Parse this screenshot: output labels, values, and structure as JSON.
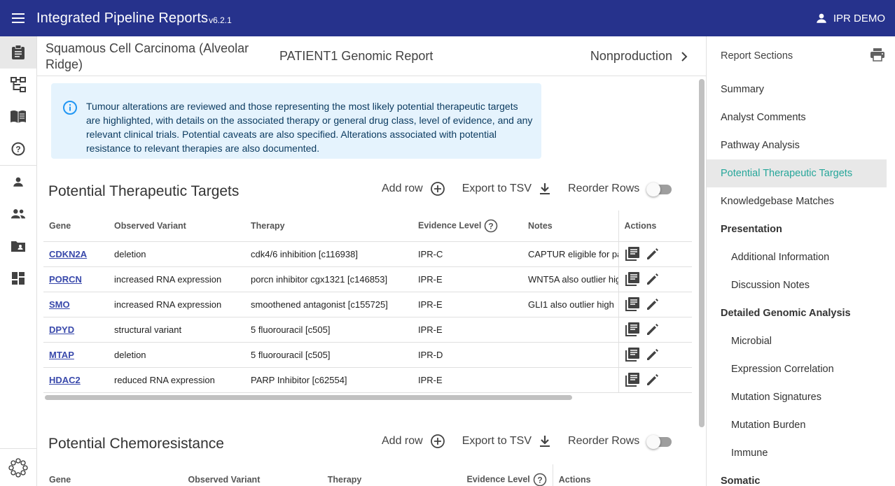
{
  "app": {
    "title": "Integrated Pipeline Reports",
    "version": "v6.2.1",
    "user": "IPR DEMO"
  },
  "header": {
    "diagnosis": "Squamous Cell Carcinoma (Alveolar Ridge)",
    "report_title": "PATIENT1 Genomic Report",
    "state": "Nonproduction"
  },
  "alert": {
    "text": "Tumour alterations are reviewed and those representing the most likely potential therapeutic targets are highlighted, with details on the associated therapy or general drug class, level of evidence, and any relevant clinical trials. Potential caveats are also specified. Alterations associated with potential resistance to relevant therapies are also documented."
  },
  "toolbar": {
    "add_row": "Add row",
    "export": "Export to TSV",
    "reorder": "Reorder Rows"
  },
  "targets": {
    "title": "Potential Therapeutic Targets",
    "columns": [
      "Gene",
      "Observed Variant",
      "Therapy",
      "Evidence Level",
      "Notes",
      "Actions"
    ],
    "rows": [
      {
        "gene": "CDKN2A",
        "variant": "deletion",
        "therapy": "cdk4/6 inhibition [c116938]",
        "level": "IPR-C",
        "notes": "CAPTUR eligible for pa"
      },
      {
        "gene": "PORCN",
        "variant": "increased RNA expression",
        "therapy": "porcn inhibitor cgx1321 [c146853]",
        "level": "IPR-E",
        "notes": "WNT5A also outlier hig"
      },
      {
        "gene": "SMO",
        "variant": "increased RNA expression",
        "therapy": "smoothened antagonist [c155725]",
        "level": "IPR-E",
        "notes": "GLI1 also outlier high"
      },
      {
        "gene": "DPYD",
        "variant": "structural variant",
        "therapy": "5 fluorouracil [c505]",
        "level": "IPR-E",
        "notes": ""
      },
      {
        "gene": "MTAP",
        "variant": "deletion",
        "therapy": "5 fluorouracil [c505]",
        "level": "IPR-D",
        "notes": ""
      },
      {
        "gene": "HDAC2",
        "variant": "reduced RNA expression",
        "therapy": "PARP Inhibitor [c62554]",
        "level": "IPR-E",
        "notes": ""
      }
    ]
  },
  "chemo": {
    "title": "Potential Chemoresistance",
    "columns": [
      "Gene",
      "Observed Variant",
      "Therapy",
      "Evidence Level",
      "Actions"
    ]
  },
  "sections_panel": {
    "title": "Report Sections",
    "items": [
      {
        "label": "Summary",
        "kind": "item"
      },
      {
        "label": "Analyst Comments",
        "kind": "item"
      },
      {
        "label": "Pathway Analysis",
        "kind": "item"
      },
      {
        "label": "Potential Therapeutic Targets",
        "kind": "active"
      },
      {
        "label": "Knowledgebase Matches",
        "kind": "item"
      },
      {
        "label": "Presentation",
        "kind": "group"
      },
      {
        "label": "Additional Information",
        "kind": "sub"
      },
      {
        "label": "Discussion Notes",
        "kind": "sub"
      },
      {
        "label": "Detailed Genomic Analysis",
        "kind": "group"
      },
      {
        "label": "Microbial",
        "kind": "sub"
      },
      {
        "label": "Expression Correlation",
        "kind": "sub"
      },
      {
        "label": "Mutation Signatures",
        "kind": "sub"
      },
      {
        "label": "Mutation Burden",
        "kind": "sub"
      },
      {
        "label": "Immune",
        "kind": "sub"
      },
      {
        "label": "Somatic",
        "kind": "group"
      }
    ]
  },
  "colors": {
    "appbar": "#26328c",
    "accent": "#26a69a",
    "link": "#3949ab",
    "alert_bg": "#e5f3fd"
  }
}
